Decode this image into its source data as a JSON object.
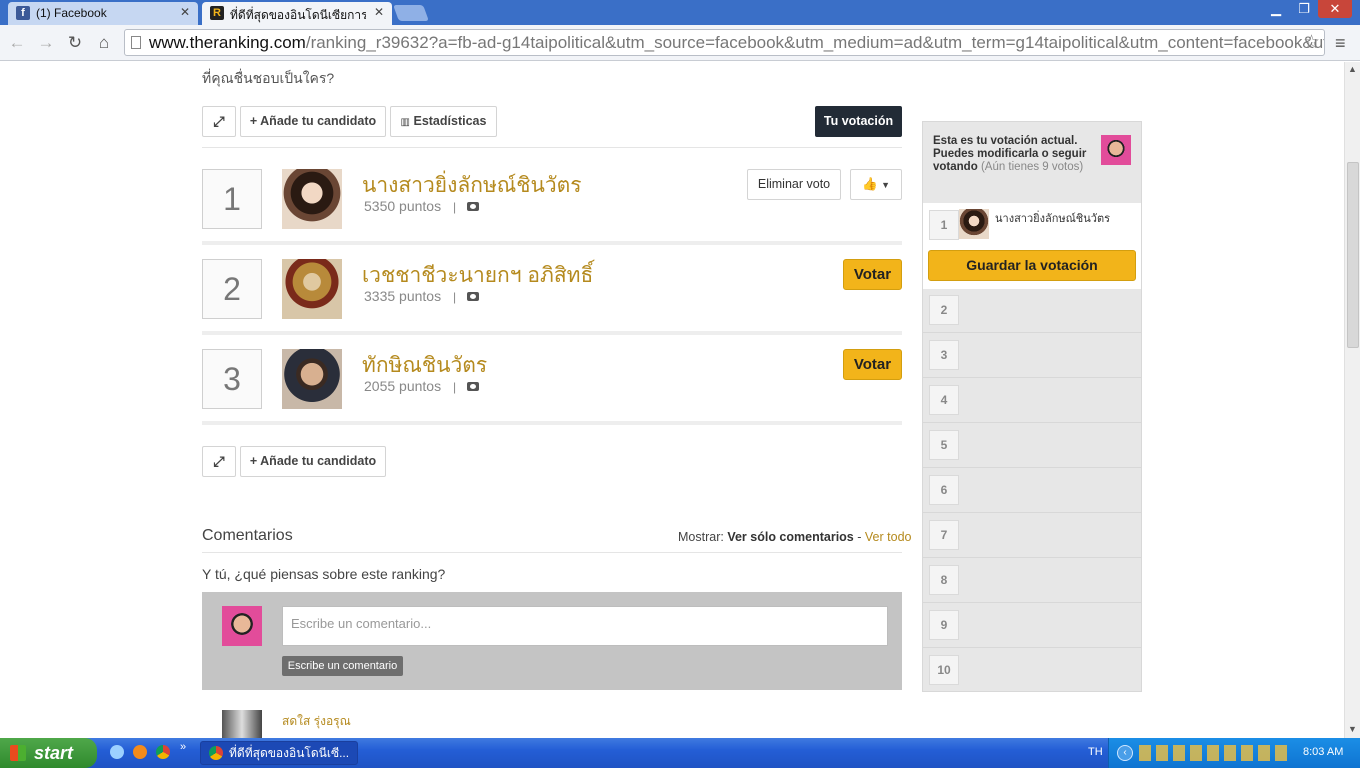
{
  "browser": {
    "tabs": [
      {
        "label": "(1) Facebook",
        "favicon_color": "#3b5998"
      },
      {
        "label": "ที่ดีที่สุดของอินโดนีเซียการเมื",
        "favicon_color": "#f2b41a"
      }
    ],
    "window_controls": {
      "minimize": "▁",
      "restore": "❐",
      "close": "✕"
    },
    "url_host": "www.theranking.com",
    "url_path": "/ranking_r39632?a=fb-ad-g14taipolitical&utm_source=facebook&utm_medium=ad&utm_term=g14taipolitical&utm_content=facebook&utm_"
  },
  "page": {
    "question": "ที่คุณชื่นชอบเป็นใคร?",
    "toolbar": {
      "expand_icon": "expand-icon",
      "add_candidate": "+ Añade tu candidato",
      "stats": "Estadísticas",
      "your_vote": "Tu votación"
    },
    "candidates": [
      {
        "rank": "1",
        "name": "นางสาวยิ่งลักษณ์ชินวัตร",
        "points": "5350 puntos",
        "action": "Eliminar voto"
      },
      {
        "rank": "2",
        "name": "เวชชาชีวะนายกฯ อภิสิทธิ์",
        "points": "3335 puntos",
        "action": "Votar"
      },
      {
        "rank": "3",
        "name": "ทักษิณชินวัตร",
        "points": "2055 puntos",
        "action": "Votar"
      }
    ],
    "separator": "|",
    "comments": {
      "title": "Comentarios",
      "show_label": "Mostrar:",
      "show_only": "Ver sólo comentarios",
      "dash": "-",
      "show_all": "Ver todo",
      "prompt": "Y tú, ¿qué piensas sobre este ranking?",
      "placeholder": "Escribe un comentario...",
      "submit": "Escribe un comentario",
      "first_commenter": "สดใส รุ่งอรุณ"
    }
  },
  "panel": {
    "intro_bold": "Esta es tu votación actual. Puedes modificarla o seguir votando",
    "intro_note": "(Aún tienes 9 votos)",
    "entry_rank": "1",
    "entry_name": "นางสาวยิ่งลักษณ์ชินวัตร",
    "save": "Guardar la votación",
    "slots": [
      "2",
      "3",
      "4",
      "5",
      "6",
      "7",
      "8",
      "9",
      "10"
    ]
  },
  "taskbar": {
    "start": "start",
    "task": "ที่ดีที่สุดของอินโดนีเซี...",
    "lang": "TH",
    "clock": "8:03 AM"
  },
  "colors": {
    "accent_gold": "#f2b41a",
    "name_gold": "#b58a1e",
    "dark_button": "#222b36"
  }
}
